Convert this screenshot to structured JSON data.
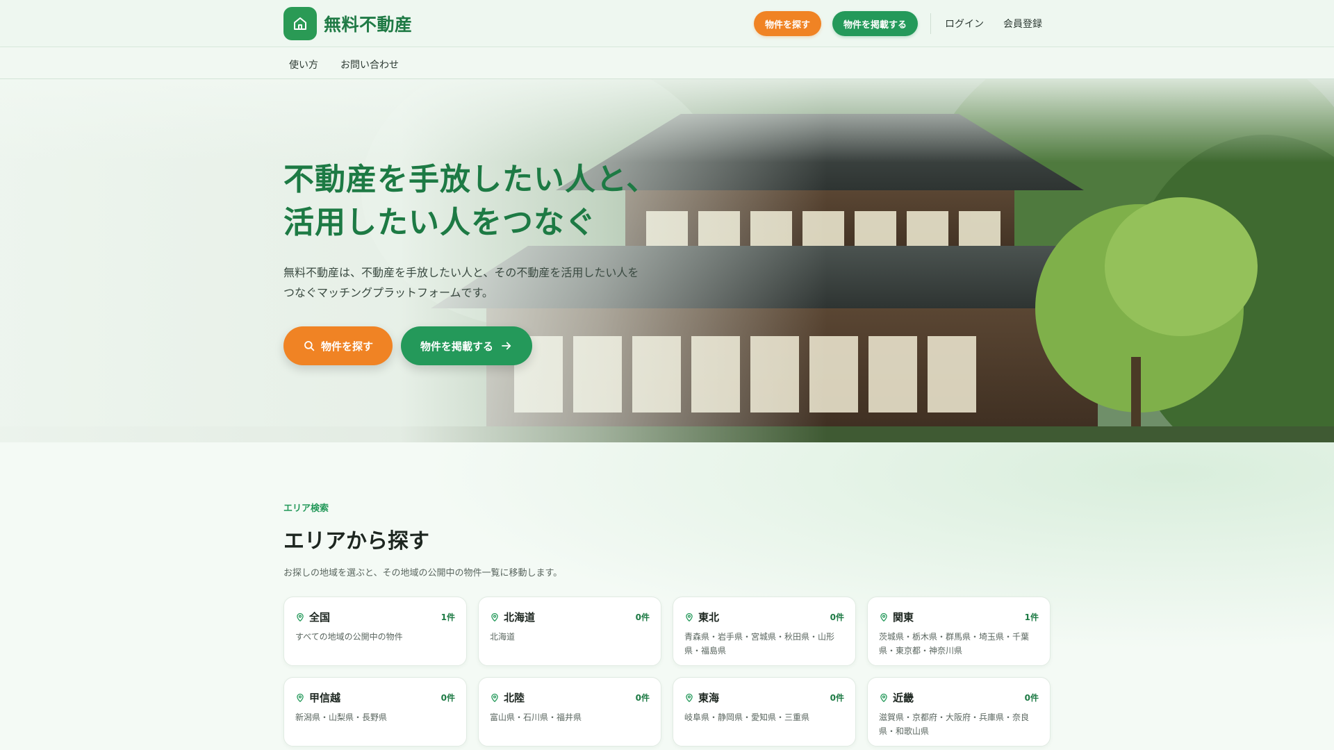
{
  "header": {
    "logo_text": "無料不動産",
    "find_button": "物件を探す",
    "post_button": "物件を掲載する",
    "login": "ログイン",
    "register": "会員登録"
  },
  "subnav": {
    "items": [
      "使い方",
      "お問い合わせ"
    ]
  },
  "hero": {
    "title_line1": "不動産を手放したい人と、",
    "title_line2": "活用したい人をつなぐ",
    "lead": "無料不動産は、不動産を手放したい人と、その不動産を活用したい人をつなぐマッチングプラットフォームです。",
    "find_button": "物件を探す",
    "post_button": "物件を掲載する"
  },
  "area": {
    "eyebrow": "エリア検索",
    "title": "エリアから探す",
    "description": "お探しの地域を選ぶと、その地域の公開中の物件一覧に移動します。",
    "regions": [
      {
        "name": "全国",
        "count": "1件",
        "sub": "すべての地域の公開中の物件"
      },
      {
        "name": "北海道",
        "count": "0件",
        "sub": "北海道"
      },
      {
        "name": "東北",
        "count": "0件",
        "sub": "青森県・岩手県・宮城県・秋田県・山形県・福島県"
      },
      {
        "name": "関東",
        "count": "1件",
        "sub": "茨城県・栃木県・群馬県・埼玉県・千葉県・東京都・神奈川県"
      },
      {
        "name": "甲信越",
        "count": "0件",
        "sub": "新潟県・山梨県・長野県"
      },
      {
        "name": "北陸",
        "count": "0件",
        "sub": "富山県・石川県・福井県"
      },
      {
        "name": "東海",
        "count": "0件",
        "sub": "岐阜県・静岡県・愛知県・三重県"
      },
      {
        "name": "近畿",
        "count": "0件",
        "sub": "滋賀県・京都府・大阪府・兵庫県・奈良県・和歌山県"
      }
    ]
  },
  "colors": {
    "brand_green": "#24995a",
    "accent_orange": "#f08324",
    "title_green": "#1d7a44"
  },
  "icons": {
    "logo": "home-icon",
    "search": "search-icon",
    "arrow": "arrow-right-icon",
    "region": "map-pin-icon"
  }
}
